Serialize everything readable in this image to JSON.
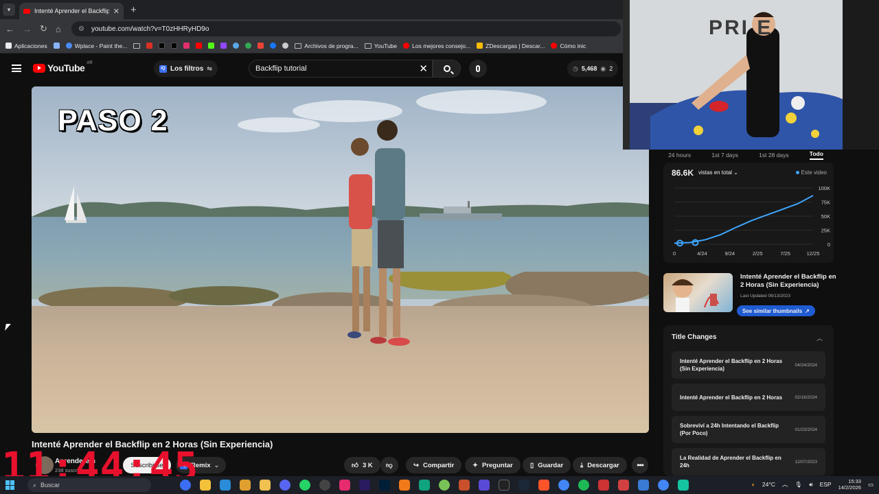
{
  "browser": {
    "tab_title": "Intenté Aprender el Backflip en",
    "url": "youtube.com/watch?v=T0zHHRyHD9o",
    "bookmarks": [
      "Aplicaciones",
      "Wplace - Paint the...",
      "Archivos de progra...",
      "YouTube",
      "Los mejores consejo...",
      "ZDescargas | Descar...",
      "Cómo inic"
    ]
  },
  "header": {
    "logo_text": "YouTube",
    "country": "AR",
    "filters_label": "Los filtros",
    "search_value": "Backflip tutorial",
    "stat_count": "5,468",
    "stat_watch": "2"
  },
  "video": {
    "overlay_text": "PASO 2",
    "title": "Intenté Aprender el Backflip en 2 Horas (Sin Experiencia)",
    "channel": "Aprenderem",
    "subscribers": "238 suscriptores",
    "subscribe_label": "Suscribirse",
    "remix_label": "Remix",
    "likes": "3 K",
    "share_label": "Compartir",
    "ask_label": "Preguntar",
    "save_label": "Guardar",
    "download_label": "Descargar"
  },
  "webcam": {
    "sign_text": "PRI E"
  },
  "sidebar": {
    "time_ranges": [
      "24 hours",
      "1st 7 days",
      "1st 28 days",
      "Todo"
    ],
    "active_range": "Todo",
    "total_views": "86.6K",
    "views_label": "vistas en total",
    "this_video_label": "Este video",
    "related_title": "Intenté Aprender el Backflip en 2 Horas (Sin Experiencia)",
    "last_updated": "Last Updated 08/13/2023",
    "similar_btn": "See similar thumbnails",
    "title_changes_label": "Title Changes",
    "title_changes": [
      {
        "title": "Intenté Aprender el Backflip en 2 Horas (Sin Experiencia)",
        "date": "04/24/2024"
      },
      {
        "title": "Intenté Aprender el Backflip en 2 Horas",
        "date": "02/16/2024"
      },
      {
        "title": "Sobreviví a 24h Intentando el Backflip (Por Poco)",
        "date": "01/23/2024"
      },
      {
        "title": "La Realidad de Aprender el Backflip en 24h",
        "date": "12/07/2023"
      }
    ]
  },
  "chart_data": {
    "type": "line",
    "x_labels": [
      "0",
      "4/24",
      "9/24",
      "2/25",
      "7/25",
      "12/25"
    ],
    "y_labels": [
      "100K",
      "75K",
      "50K",
      "25K",
      "0"
    ],
    "ylim": [
      0,
      100000
    ],
    "series": [
      {
        "values": [
          2000,
          3000,
          8000,
          17000,
          30000,
          42000,
          52000,
          62000,
          72000,
          86600
        ]
      }
    ],
    "line_color": "#3ea6ff"
  },
  "overlay_clock": "11:44:45",
  "taskbar": {
    "search_placeholder": "Buscar",
    "temperature": "24°C",
    "lang": "ESP",
    "time": "15:33",
    "date": "14/2/2026"
  }
}
